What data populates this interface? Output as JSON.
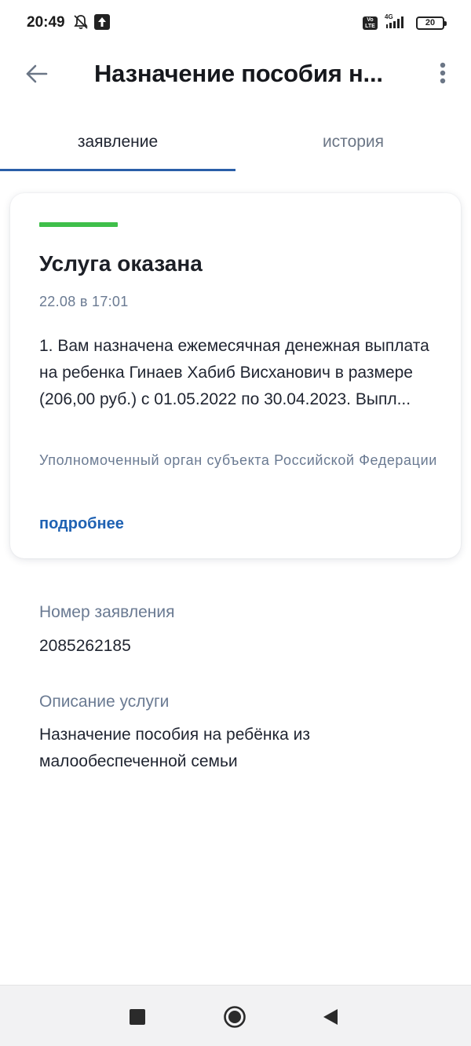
{
  "status_bar": {
    "time": "20:49",
    "network": "4G",
    "volte_top": "Vo",
    "volte_bottom": "LTE",
    "battery": "20",
    "icons": [
      "bell-off-icon",
      "upload-icon",
      "volte-icon",
      "signal-icon",
      "battery-icon"
    ]
  },
  "app_bar": {
    "title": "Назначение пособия н...",
    "back_icon": "arrow-left-icon",
    "menu_icon": "more-vertical-icon"
  },
  "tabs": [
    {
      "label": "заявление",
      "active": true
    },
    {
      "label": "история",
      "active": false
    }
  ],
  "card": {
    "status_color": "#3fbf4a",
    "title": "Услуга оказана",
    "date": "22.08 в 17:01",
    "text": "1. Вам назначена ежемесячная денежная выплата на ребенка Гинаев Хабиб Висханович в размере (206,00 руб.) с 01.05.2022 по 30.04.2023. Выпл...",
    "org": "Уполномоченный орган субъекта Российской Федерации",
    "link": "подробнее"
  },
  "fields": [
    {
      "label": "Номер заявления",
      "value": "2085262185"
    },
    {
      "label": "Описание услуги",
      "value": "Назначение пособия на ребёнка из малообеспеченной семьи"
    }
  ],
  "nav_bar": {
    "icons": [
      "recents-square-icon",
      "home-circle-icon",
      "back-triangle-icon"
    ]
  },
  "colors": {
    "accent": "#2a5ea8",
    "link": "#1f62b3",
    "success": "#3fbf4a",
    "muted": "#6a7a92"
  }
}
